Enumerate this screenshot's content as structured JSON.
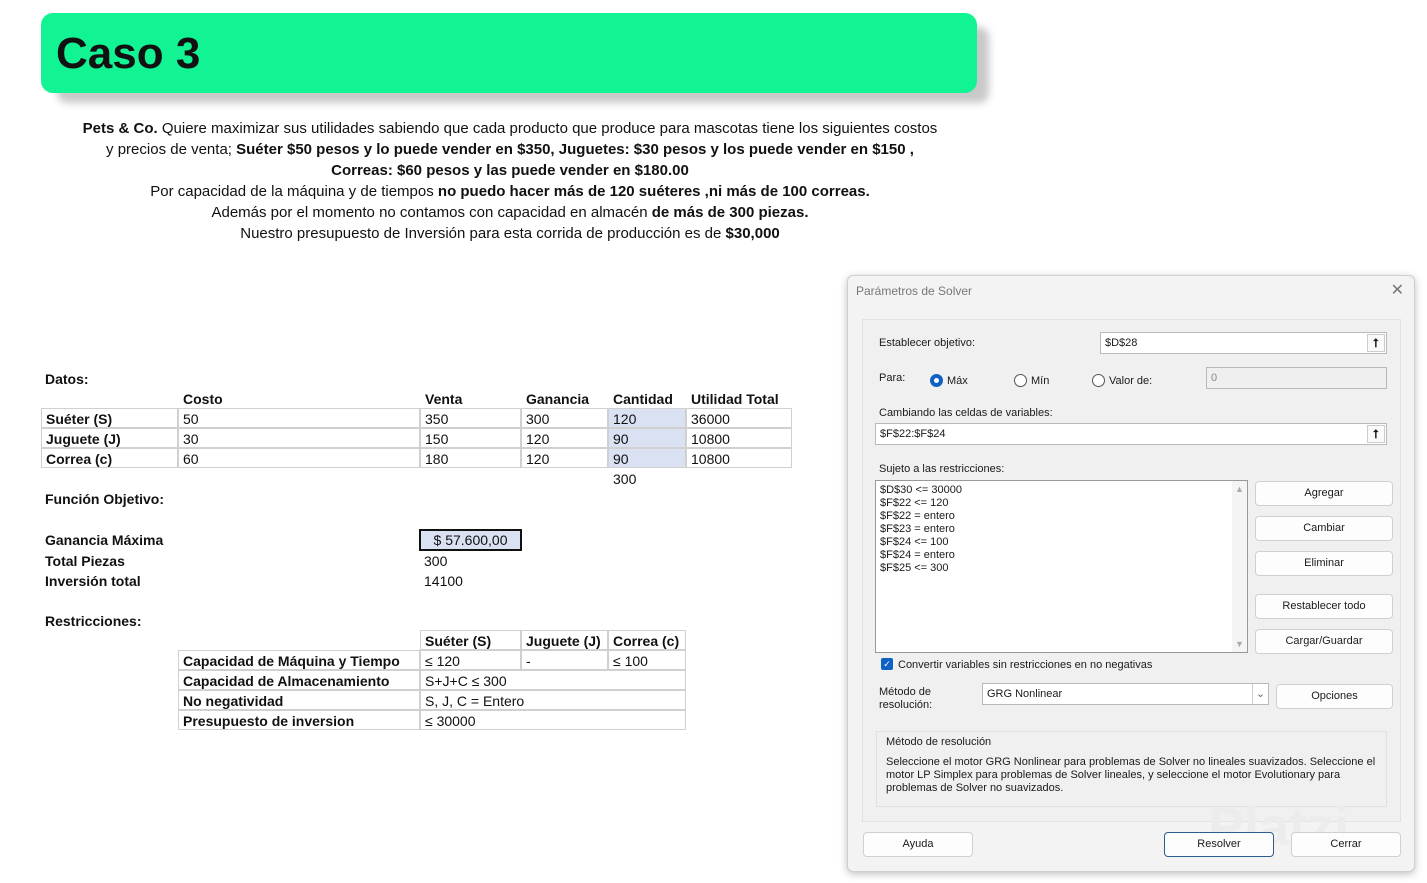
{
  "title": "Caso 3",
  "intro": {
    "l1a": "Pets & Co.",
    "l1b": " Quiere maximizar sus utilidades sabiendo que cada producto que produce para mascotas tiene los siguientes costos",
    "l2a": "y precios de venta; ",
    "l2b": "Suéter $50 pesos y lo puede vender en $350, Juguetes: $30 pesos y los puede vender en $150 ,",
    "l3": "Correas: $60 pesos y las puede vender en $180.00",
    "l4a": "Por capacidad de la máquina y de tiempos ",
    "l4b": "no puedo hacer más de 120 suéteres ,ni más de 100 correas.",
    "l5a": "Además por el momento no contamos con capacidad en almacén ",
    "l5b": "de más de 300 piezas.",
    "l6a": "Nuestro presupuesto de Inversión para esta corrida de producción es de ",
    "l6b": "$30,000"
  },
  "datos": {
    "label": "Datos:",
    "headers": [
      "Costo",
      "Venta",
      "Ganancia",
      "Cantidad",
      "Utilidad Total"
    ],
    "rows": [
      [
        "Suéter (S)",
        "50",
        "350",
        "300",
        "120",
        "36000"
      ],
      [
        "Juguete (J)",
        "30",
        "150",
        "120",
        "90",
        "10800"
      ],
      [
        "Correa (c)",
        "60",
        "180",
        "120",
        "90",
        "10800"
      ]
    ],
    "total_cantidad": "300"
  },
  "funcion": {
    "label": "Función Objetivo:",
    "ganancia_label": "Ganancia Máxima",
    "ganancia": "$ 57.600,00",
    "piezas_label": "Total Piezas",
    "piezas": "300",
    "inversion_label": "Inversión total",
    "inversion": "14100"
  },
  "restricciones": {
    "label": "Restricciones:",
    "headers": [
      "Suéter (S)",
      "Juguete (J)",
      "Correa (c)"
    ],
    "rows": [
      [
        "Capacidad de Máquina y Tiempo",
        "≤ 120",
        "-",
        "≤ 100"
      ],
      [
        "Capacidad de Almacenamiento",
        "S+J+C ≤ 300"
      ],
      [
        "No negatividad",
        "S, J, C = Entero"
      ],
      [
        "Presupuesto de inversion",
        "≤ 30000"
      ]
    ]
  },
  "solver": {
    "title": "Parámetros de Solver",
    "objetivo_label": "Establecer objetivo:",
    "objetivo": "$D$28",
    "para_label": "Para:",
    "max": "Máx",
    "min": "Mín",
    "valor": "Valor de:",
    "valor_value": "0",
    "selected": "Máx",
    "cambiando_label": "Cambiando las celdas de variables:",
    "cambiando": "$F$22:$F$24",
    "sujeto_label": "Sujeto a las restricciones:",
    "constraints": [
      "$D$30 <= 30000",
      "$F$22 <= 120",
      "$F$22 = entero",
      "$F$23 = entero",
      "$F$24 <= 100",
      "$F$24 = entero",
      "$F$25 <= 300"
    ],
    "buttons": {
      "agregar": "Agregar",
      "cambiar": "Cambiar",
      "eliminar": "Eliminar",
      "restablecer": "Restablecer todo",
      "cargar": "Cargar/Guardar",
      "opciones": "Opciones",
      "ayuda": "Ayuda",
      "resolver": "Resolver",
      "cerrar": "Cerrar"
    },
    "checkbox": "Convertir variables sin restricciones en no negativas",
    "checkbox_checked": true,
    "metodo_label1": "Método de",
    "metodo_label2": "resolución:",
    "metodo": "GRG Nonlinear",
    "desc_title": "Método de resolución",
    "desc": "Seleccione el motor GRG Nonlinear para problemas de Solver no lineales suavizados. Seleccione el motor LP Simplex para problemas de Solver lineales, y seleccione el motor Evolutionary para problemas de Solver no suavizados.",
    "accent": "#0f62c4"
  },
  "watermark": "Platzi"
}
